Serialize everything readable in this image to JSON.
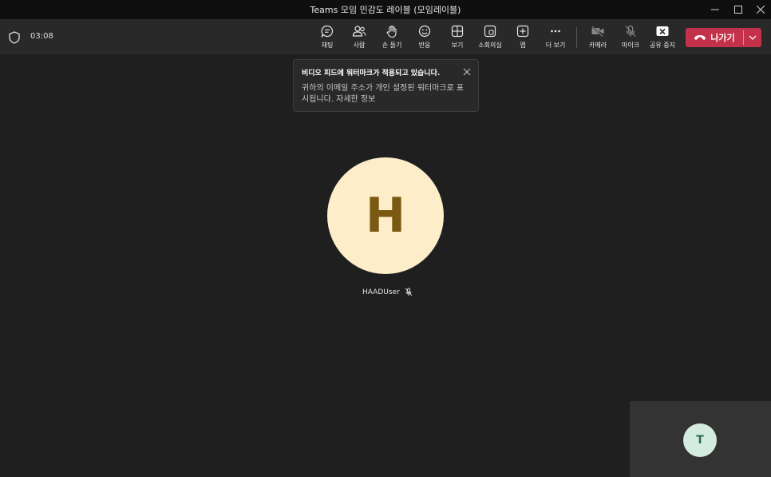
{
  "window": {
    "title": "Teams 모임 민감도 레이블 (모임레이블)"
  },
  "toolbar": {
    "timer": "03:08",
    "buttons": [
      {
        "label": "채팅",
        "icon": "chat-icon"
      },
      {
        "label": "사람",
        "icon": "people-icon"
      },
      {
        "label": "손 들기",
        "icon": "hand-icon"
      },
      {
        "label": "반응",
        "icon": "emoji-icon"
      },
      {
        "label": "보기",
        "icon": "grid-icon"
      },
      {
        "label": "소회의실",
        "icon": "breakout-icon"
      },
      {
        "label": "앱",
        "icon": "plus-icon"
      },
      {
        "label": "더 보기",
        "icon": "more-icon"
      },
      {
        "label": "카메라",
        "icon": "camera-off-icon"
      },
      {
        "label": "마이크",
        "icon": "mic-off-icon"
      },
      {
        "label": "공유 중지",
        "icon": "stop-share-icon"
      }
    ],
    "leave_label": "나가기"
  },
  "toast": {
    "title": "비디오 피드에 워터마크가 적용되고 있습니다.",
    "body": "귀하의 이메일 주소가 개인 설정된 워터마크로 표시됩니다. 자세한 정보"
  },
  "main_participant": {
    "initial": "H",
    "name": "HAADUser"
  },
  "self_tile": {
    "initial": "T"
  },
  "colors": {
    "leave": "#c4314b",
    "avatar_h": "#fdedc9",
    "avatar_t": "#d4ecdf"
  }
}
